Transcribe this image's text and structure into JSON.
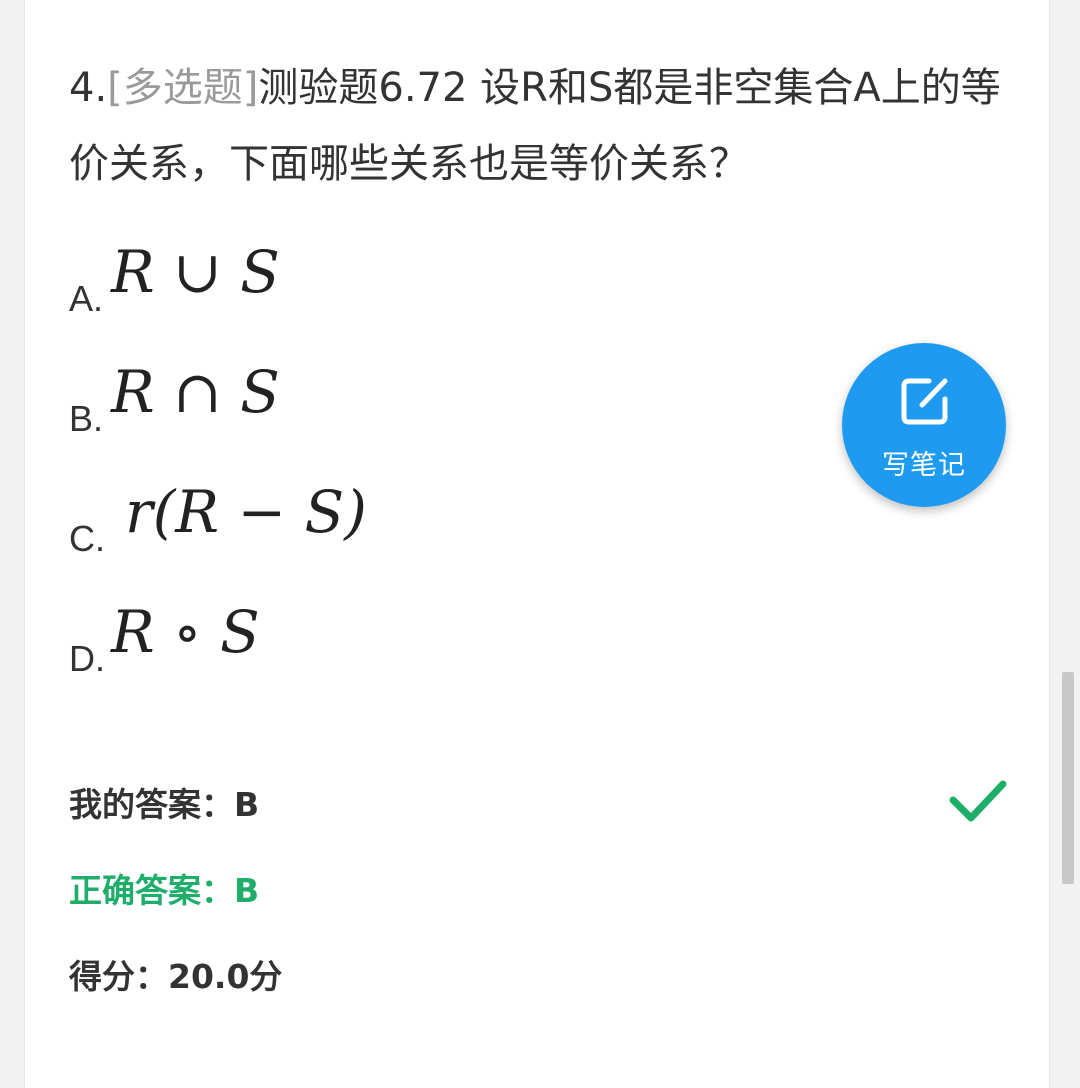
{
  "question": {
    "number": "4.",
    "type": "[多选题]",
    "text": "测验题6.72 设R和S都是非空集合A上的等价关系，下面哪些关系也是等价关系？"
  },
  "options": [
    {
      "letter": "A.",
      "math": "R ∪ S"
    },
    {
      "letter": "B.",
      "math": "R ∩ S"
    },
    {
      "letter": "C.",
      "math": "r(R − S)"
    },
    {
      "letter": "D.",
      "math": "R ∘ S"
    }
  ],
  "result": {
    "my_answer": "我的答案：B",
    "correct_answer": "正确答案：B",
    "score": "得分：20.0分",
    "status_icon": "check-icon",
    "correct_color": "#1fae6a"
  },
  "note_button": {
    "label": "写笔记",
    "icon": "edit-note-icon",
    "color": "#1e9bf0"
  }
}
